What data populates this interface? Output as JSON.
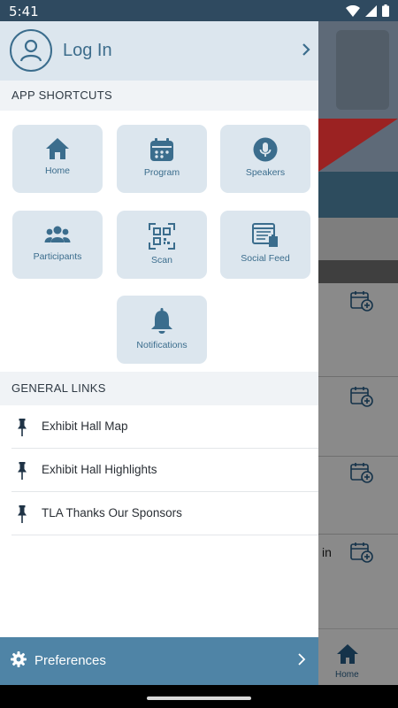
{
  "status_bar": {
    "time": "5:41"
  },
  "drawer": {
    "login_label": "Log In",
    "shortcuts_title": "APP SHORTCUTS",
    "shortcuts": [
      {
        "label": "Home",
        "icon": "home-icon"
      },
      {
        "label": "Program",
        "icon": "calendar-icon"
      },
      {
        "label": "Speakers",
        "icon": "microphone-icon"
      },
      {
        "label": "Participants",
        "icon": "people-icon"
      },
      {
        "label": "Scan",
        "icon": "qr-scan-icon"
      },
      {
        "label": "Social Feed",
        "icon": "social-feed-icon"
      },
      {
        "label": "Notifications",
        "icon": "bell-icon"
      }
    ],
    "links_title": "GENERAL LINKS",
    "links": [
      {
        "label": "Exhibit Hall Map",
        "icon": "pin-icon"
      },
      {
        "label": "Exhibit Hall Highlights",
        "icon": "pin-icon"
      },
      {
        "label": "TLA Thanks Our Sponsors",
        "icon": "pin-icon"
      }
    ],
    "preferences_label": "Preferences"
  },
  "background_app": {
    "partial_text": "in",
    "nav_home_label": "Home"
  },
  "colors": {
    "accent": "#3b6d8d",
    "tile_bg": "#dce6ee",
    "preferences_bar": "#4f84a6",
    "status_bar": "#2f4a60"
  }
}
